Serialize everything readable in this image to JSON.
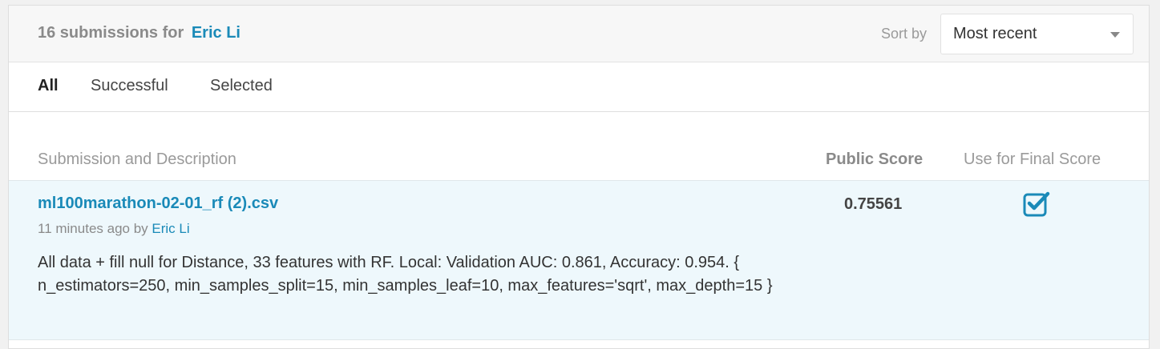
{
  "header": {
    "count_text": "16 submissions for",
    "user_name": "Eric Li",
    "sort_label": "Sort by",
    "sort_value": "Most recent"
  },
  "tabs": [
    {
      "label": "All",
      "active": true
    },
    {
      "label": "Successful",
      "active": false
    },
    {
      "label": "Selected",
      "active": false
    }
  ],
  "columns": {
    "submission": "Submission and Description",
    "public_score": "Public Score",
    "final": "Use for Final Score"
  },
  "submissions": [
    {
      "file": "ml100marathon-02-01_rf (2).csv",
      "time": "11 minutes ago by",
      "author": "Eric Li",
      "description": "All data + fill null for Distance, 33 features with RF. Local: Validation AUC: 0.861, Accuracy: 0.954. { n_estimators=250, min_samples_split=15, min_samples_leaf=10, max_features='sqrt', max_depth=15 }",
      "score": "0.75561",
      "selected": true
    }
  ],
  "colors": {
    "accent": "#1a8ab8",
    "row_highlight": "#eef8fc",
    "checkbox": "#1a8ab8"
  },
  "icons": {
    "sort_caret": "chevron-down-icon",
    "final_checkbox": "checkbox-checked-icon"
  }
}
